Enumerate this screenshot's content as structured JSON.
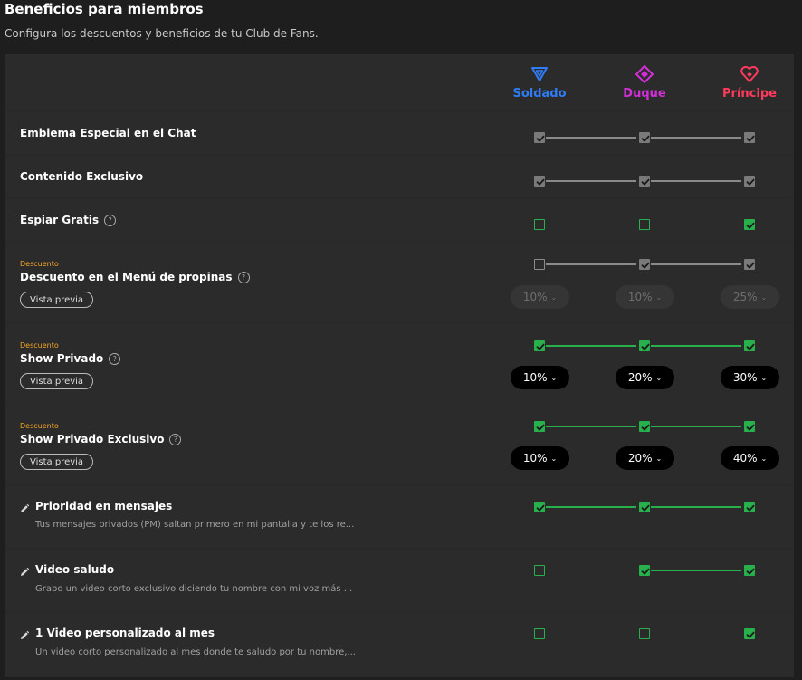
{
  "header": {
    "title": "Beneficios para miembros",
    "subtitle": "Configura los descuentos y beneficios de tu Club de Fans."
  },
  "tiers": [
    {
      "name": "Soldado",
      "color": "#2f7cf6",
      "icon": "triangle-down-icon"
    },
    {
      "name": "Duque",
      "color": "#d22fd9",
      "icon": "diamond-icon"
    },
    {
      "name": "Príncipe",
      "color": "#ff3a5c",
      "icon": "heart-gem-icon"
    }
  ],
  "common": {
    "preview_label": "Vista previa",
    "discount_tag": "Descuento",
    "help_glyph": "?"
  },
  "benefits": [
    {
      "label": "Emblema Especial en el Chat",
      "checks": [
        true,
        true,
        true
      ],
      "style": "gray"
    },
    {
      "label": "Contenido Exclusivo",
      "checks": [
        true,
        true,
        true
      ],
      "style": "gray"
    },
    {
      "label": "Espiar Gratis",
      "help": true,
      "checks": [
        false,
        false,
        true
      ],
      "style": "green"
    },
    {
      "label": "Descuento en el Menú de propinas",
      "help": true,
      "tag": "Descuento",
      "checks": [
        false,
        true,
        true
      ],
      "style": "gray",
      "discounts": [
        "10%",
        "10%",
        "25%"
      ],
      "discount_state": "disabled"
    },
    {
      "label": "Show Privado",
      "help": true,
      "tag": "Descuento",
      "checks": [
        true,
        true,
        true
      ],
      "style": "green",
      "discounts": [
        "10%",
        "20%",
        "30%"
      ],
      "discount_state": "active"
    },
    {
      "label": "Show Privado Exclusivo",
      "help": true,
      "tag": "Descuento",
      "checks": [
        true,
        true,
        true
      ],
      "style": "green",
      "discounts": [
        "10%",
        "20%",
        "40%"
      ],
      "discount_state": "active"
    },
    {
      "label": "Prioridad en mensajes",
      "description": "Tus mensajes privados (PM) saltan primero en mi pantalla y te los re...",
      "checks": [
        true,
        true,
        true
      ],
      "style": "green"
    },
    {
      "label": "Video saludo",
      "description": "Grabo un video corto exclusivo diciendo tu nombre con mi voz más ...",
      "checks": [
        false,
        true,
        true
      ],
      "style": "green"
    },
    {
      "label": "1 Video personalizado al mes",
      "description": "Un video corto personalizado al mes donde te saludo por tu nombre,...",
      "checks": [
        false,
        false,
        true
      ],
      "style": "green"
    }
  ]
}
